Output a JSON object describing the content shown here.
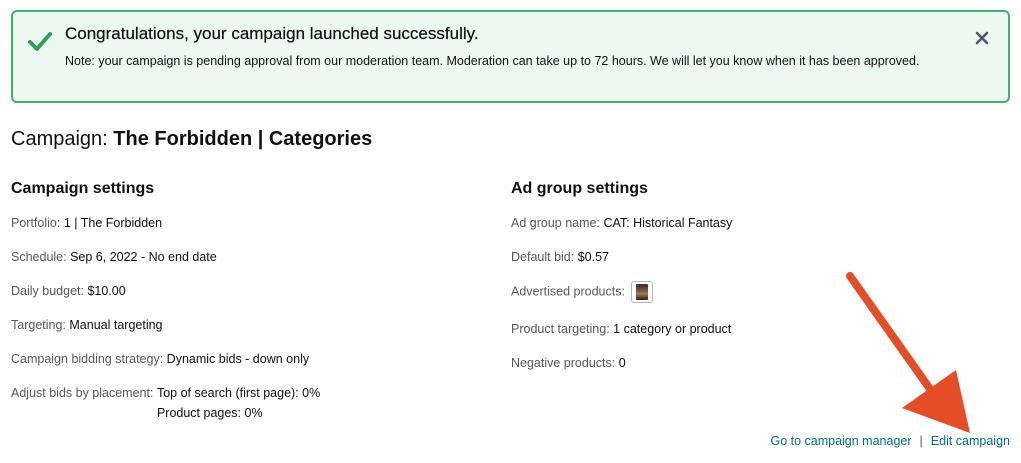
{
  "alert": {
    "title": "Congratulations, your campaign launched successfully.",
    "note": "Note: your campaign is pending approval from our moderation team. Moderation can take up to 72 hours. We will let you know when it has been approved."
  },
  "campaign": {
    "prefix": "Campaign:",
    "name": "The Forbidden | Categories"
  },
  "campaign_settings": {
    "heading": "Campaign settings",
    "portfolio_label": "Portfolio:",
    "portfolio_value": "1 | The Forbidden",
    "schedule_label": "Schedule:",
    "schedule_value": "Sep 6, 2022 - No end date",
    "budget_label": "Daily budget:",
    "budget_value": "$10.00",
    "targeting_label": "Targeting:",
    "targeting_value": "Manual targeting",
    "bidding_label": "Campaign bidding strategy:",
    "bidding_value": "Dynamic bids - down only",
    "placement_label": "Adjust bids by placement:",
    "placement_value_1": "Top of search (first page): 0%",
    "placement_value_2": "Product pages: 0%"
  },
  "ad_group_settings": {
    "heading": "Ad group settings",
    "name_label": "Ad group name:",
    "name_value": "CAT: Historical Fantasy",
    "bid_label": "Default bid:",
    "bid_value": "$0.57",
    "products_label": "Advertised products:",
    "targeting_label": "Product targeting:",
    "targeting_value": "1 category or product",
    "negative_label": "Negative products:",
    "negative_value": "0"
  },
  "footer_links": {
    "manager": "Go to campaign manager",
    "separator": "|",
    "edit": "Edit campaign"
  },
  "colors": {
    "success": "#3cb371",
    "link": "#007185",
    "arrow": "#e44d26"
  },
  "icons": [
    "checkmark-icon",
    "close-icon",
    "product-thumbnail",
    "annotation-arrow"
  ]
}
